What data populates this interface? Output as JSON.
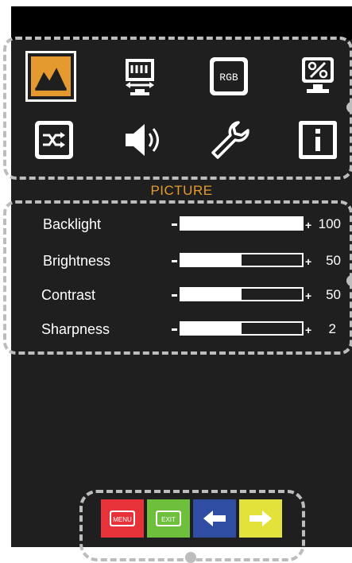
{
  "section_title": "PICTURE",
  "menu_icons": [
    {
      "icon": "picture-icon",
      "selected": true
    },
    {
      "icon": "screen-position-icon",
      "selected": false
    },
    {
      "icon": "rgb-icon",
      "label": "RGB",
      "selected": false
    },
    {
      "icon": "percent-adjust-icon",
      "selected": false
    },
    {
      "icon": "input-source-icon",
      "selected": false
    },
    {
      "icon": "audio-icon",
      "selected": false
    },
    {
      "icon": "settings-wrench-icon",
      "selected": false
    },
    {
      "icon": "info-icon",
      "selected": false
    }
  ],
  "settings": [
    {
      "label": "Backlight",
      "value": "100",
      "level": 1.0
    },
    {
      "label": "Brightness",
      "value": "50",
      "level": 0.5
    },
    {
      "label": "Contrast",
      "value": "50",
      "level": 0.5
    },
    {
      "label": "Sharpness",
      "value": "2",
      "level": 0.5
    }
  ],
  "nav_buttons": [
    {
      "label": "MENU",
      "color": "#e8323a"
    },
    {
      "label": "EXIT",
      "color": "#6dbf3c"
    },
    {
      "icon": "arrow-left-icon",
      "color": "#2f4ea3"
    },
    {
      "icon": "arrow-right-icon",
      "color": "#e3e23a"
    }
  ],
  "colors": {
    "accent": "#e59a2f",
    "panel": "#1f1f1f"
  }
}
